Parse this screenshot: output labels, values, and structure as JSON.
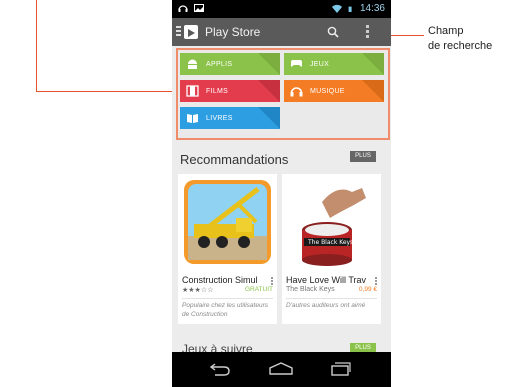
{
  "statusbar": {
    "time": "14:36"
  },
  "appbar": {
    "title": "Play Store"
  },
  "categories": [
    {
      "label": "APPLIS",
      "color": "#8bc34a",
      "shade": "#7cad3f",
      "icon": "android-icon"
    },
    {
      "label": "JEUX",
      "color": "#8bc34a",
      "shade": "#7cad3f",
      "icon": "gamepad-icon"
    },
    {
      "label": "FILMS",
      "color": "#e23c4d",
      "shade": "#c6303f",
      "icon": "film-icon"
    },
    {
      "label": "MUSIQUE",
      "color": "#f47c24",
      "shade": "#d96a18",
      "icon": "headphones-icon"
    },
    {
      "label": "LIVRES",
      "color": "#2e9ee3",
      "shade": "#2186c5",
      "icon": "book-icon"
    }
  ],
  "recommendations": {
    "title": "Recommandations",
    "more_label": "PLUS",
    "cards": [
      {
        "name": "Construction Simul",
        "publisher": "★★★☆☆",
        "price": "GRATUIT",
        "price_color": "#8bc34a",
        "note": "Populaire chez les utilisateurs de Construction"
      },
      {
        "name": "Have Love Will Trav",
        "publisher": "The Black Keys",
        "price": "0,99 €",
        "price_color": "#f47c24",
        "note": "D'autres auditeurs ont aimé"
      }
    ]
  },
  "next_section": {
    "title": "Jeux à suivre",
    "more_label": "PLUS"
  },
  "callout": {
    "line1": "Champ",
    "line2": "de recherche"
  },
  "accent_color": "#e8502f"
}
